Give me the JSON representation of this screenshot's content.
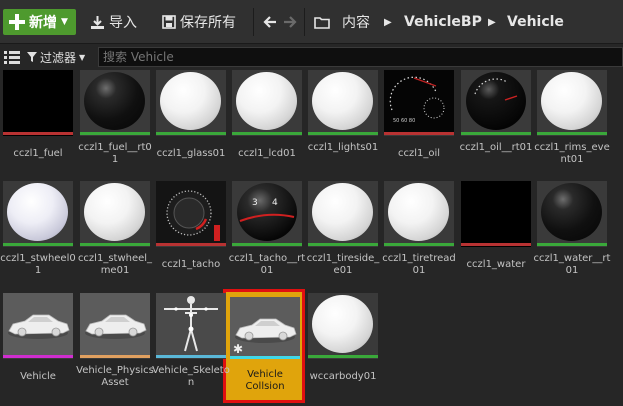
{
  "toolbar": {
    "new_label": "新增",
    "import_label": "导入",
    "save_all_label": "保存所有",
    "breadcrumb": [
      "内容",
      "VehicleBP",
      "Vehicle"
    ]
  },
  "filter": {
    "filter_label": "过滤器",
    "search_placeholder": "搜索 Vehicle"
  },
  "colors": {
    "accent_green": "#4e9a2e",
    "material_bar": "#3aa83a",
    "texture_bar": "#b83232",
    "mesh_bar": "#d02ed0",
    "physics_bar": "#e0a060",
    "skeleton_bar": "#5ab8d8",
    "collision_bar": "#40d8e8",
    "selection_fill": "#e0a40c",
    "selection_border": "#e01010"
  },
  "assets": [
    {
      "name": "cczl1_fuel",
      "thumb": "texture-black"
    },
    {
      "name": "cczl1_fuel__rt01",
      "thumb": "sphere-black"
    },
    {
      "name": "cczl1_glass01",
      "thumb": "sphere-white"
    },
    {
      "name": "cczl1_lcd01",
      "thumb": "sphere-white"
    },
    {
      "name": "cczl1_lights01",
      "thumb": "sphere-white"
    },
    {
      "name": "cczl1_oil",
      "thumb": "texture-gauges"
    },
    {
      "name": "cczl1_oil__rt01",
      "thumb": "sphere-gauge"
    },
    {
      "name": "cczl1_rims_event01",
      "thumb": "sphere-white"
    },
    {
      "name": "cczl1_stwheel01",
      "thumb": "sphere-bluish"
    },
    {
      "name": "cczl1_stwheel_me01",
      "thumb": "sphere-white"
    },
    {
      "name": "cczl1_tacho",
      "thumb": "texture-tacho"
    },
    {
      "name": "cczl1_tacho__rt01",
      "thumb": "sphere-tacho"
    },
    {
      "name": "cczl1_tireside_e01",
      "thumb": "sphere-white"
    },
    {
      "name": "cczl1_tiretread01",
      "thumb": "sphere-white"
    },
    {
      "name": "cczl1_water",
      "thumb": "texture-black"
    },
    {
      "name": "cczl1_water__rt01",
      "thumb": "sphere-black"
    },
    {
      "name": "Vehicle",
      "thumb": "car"
    },
    {
      "name": "Vehicle_PhysicsAsset",
      "thumb": "car"
    },
    {
      "name": "Vehicle_Skeleton",
      "thumb": "skeleton"
    },
    {
      "name": "Vehicle Collsion",
      "thumb": "car",
      "selected": true
    },
    {
      "name": "wccarbody01",
      "thumb": "sphere-white"
    }
  ]
}
